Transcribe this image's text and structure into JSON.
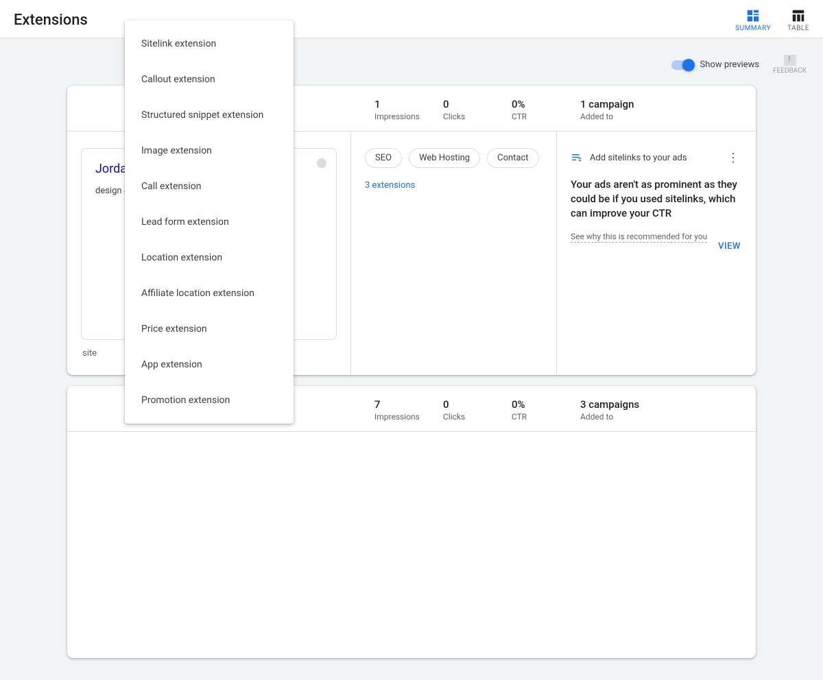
{
  "header": {
    "title": "Extensions",
    "tabs": {
      "summary": "SUMMARY",
      "table": "TABLE"
    }
  },
  "prefs": {
    "show_previews": "Show previews",
    "feedback": "FEEDBACK"
  },
  "menu": {
    "items": [
      "Sitelink extension",
      "Callout extension",
      "Structured snippet extension",
      "Image extension",
      "Call extension",
      "Lead form extension",
      "Location extension",
      "Affiliate location extension",
      "Price extension",
      "App extension",
      "Promotion extension"
    ]
  },
  "cards": [
    {
      "stats": {
        "impressions": {
          "value": "1",
          "label": "Impressions"
        },
        "clicks": {
          "value": "0",
          "label": "Clicks"
        },
        "ctr": {
          "value": "0%",
          "label": "CTR"
        },
        "added": {
          "value": "1 campaign",
          "label": "Added to"
        }
      },
      "preview": {
        "headline": "Jordan | With Digital…",
        "desc": "design & digital . We are dealing ervice provider.",
        "caption": "site"
      },
      "chips": [
        "SEO",
        "Web Hosting",
        "Contact"
      ],
      "ext_link": "3 extensions",
      "rec": {
        "title": "Add sitelinks to your ads",
        "body": "Your ads aren't as prominent as they could be if you used sitelinks, which can improve your CTR",
        "why": "See why this is recommended for you",
        "view": "VIEW"
      }
    },
    {
      "stats": {
        "impressions": {
          "value": "7",
          "label": "Impressions"
        },
        "clicks": {
          "value": "0",
          "label": "Clicks"
        },
        "ctr": {
          "value": "0%",
          "label": "CTR"
        },
        "added": {
          "value": "3 campaigns",
          "label": "Added to"
        }
      }
    }
  ]
}
